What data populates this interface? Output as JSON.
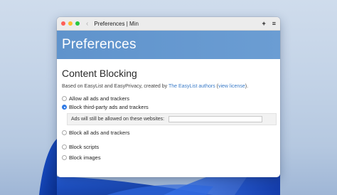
{
  "window": {
    "title": "Preferences | Min",
    "back_icon": "chevron-left-icon",
    "toolbar_icons": [
      "plus-icon",
      "hamburger-menu-icon"
    ],
    "new_tab_glyph": "+",
    "menu_glyph": "≡"
  },
  "banner": {
    "heading": "Preferences"
  },
  "content_blocking": {
    "title": "Content Blocking",
    "desc_prefix": "Based on EasyList and EasyPrivacy, created by ",
    "authors_link": "The EasyList authors",
    "desc_mid": " (",
    "license_link": "view license",
    "desc_suffix": ").",
    "options": {
      "allow_all": {
        "label": "Allow all ads and trackers",
        "selected": false
      },
      "block_third_party": {
        "label": "Block third-party ads and trackers",
        "selected": true
      },
      "allowed_sites_label": "Ads will still be allowed on these websites:",
      "allowed_sites_value": "",
      "block_all": {
        "label": "Block all ads and trackers",
        "selected": false
      }
    },
    "block_scripts": {
      "label": "Block scripts",
      "checked": false
    },
    "block_images": {
      "label": "Block images",
      "checked": false
    }
  },
  "colors": {
    "banner": "#6b9dd3",
    "accent": "#2f7ae5",
    "link": "#3a7bc8"
  }
}
